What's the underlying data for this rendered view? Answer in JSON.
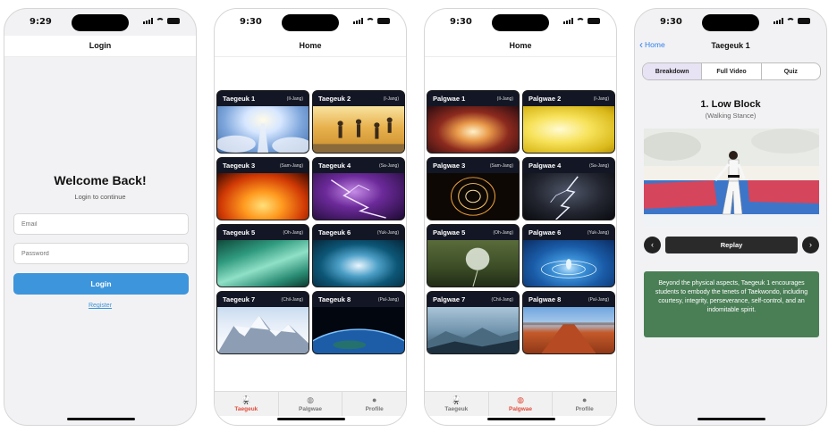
{
  "screens": {
    "login": {
      "time": "9:29",
      "title": "Login",
      "heading": "Welcome Back!",
      "subheading": "Login to continue",
      "email_placeholder": "Email",
      "password_placeholder": "Password",
      "login_label": "Login",
      "register_label": "Register"
    },
    "home_taegeuk": {
      "time": "9:30",
      "title": "Home",
      "cards": [
        {
          "name": "Taegeuk 1",
          "sub": "(Il-Jang)"
        },
        {
          "name": "Taegeuk 2",
          "sub": "(I-Jang)"
        },
        {
          "name": "Taegeuk 3",
          "sub": "(Sam-Jang)"
        },
        {
          "name": "Taegeuk 4",
          "sub": "(Sa-Jang)"
        },
        {
          "name": "Taegeuk 5",
          "sub": "(Oh-Jang)"
        },
        {
          "name": "Taegeuk 6",
          "sub": "(Yuk-Jang)"
        },
        {
          "name": "Taegeuk 7",
          "sub": "(Chil-Jang)"
        },
        {
          "name": "Taegeuk 8",
          "sub": "(Pal-Jang)"
        }
      ],
      "tabs": [
        "Taegeuk",
        "Palgwae",
        "Profile"
      ],
      "active_tab": "Taegeuk"
    },
    "home_palgwae": {
      "time": "9:30",
      "title": "Home",
      "cards": [
        {
          "name": "Palgwae 1",
          "sub": "(Il-Jang)"
        },
        {
          "name": "Palgwae 2",
          "sub": "(I-Jang)"
        },
        {
          "name": "Palgwae 3",
          "sub": "(Sam-Jang)"
        },
        {
          "name": "Palgwae 4",
          "sub": "(Sa-Jang)"
        },
        {
          "name": "Palgwae 5",
          "sub": "(Oh-Jang)"
        },
        {
          "name": "Palgwae 6",
          "sub": "(Yuk-Jang)"
        },
        {
          "name": "Palgwae 7",
          "sub": "(Chil-Jang)"
        },
        {
          "name": "Palgwae 8",
          "sub": "(Pal-Jang)"
        }
      ],
      "tabs": [
        "Taegeuk",
        "Palgwae",
        "Profile"
      ],
      "active_tab": "Palgwae"
    },
    "detail": {
      "time": "9:30",
      "back_label": "Home",
      "title": "Taegeuk 1",
      "segments": [
        "Breakdown",
        "Full Video",
        "Quiz"
      ],
      "active_segment": "Breakdown",
      "step_title": "1. Low Block",
      "step_subtitle": "(Walking Stance)",
      "replay_label": "Replay",
      "info_text": "Beyond the physical aspects, Taegeuk 1 encourages students to embody the tenets of Taekwondo, including courtesy, integrity, perseverance, self-control, and an indomitable spirit."
    }
  },
  "icons": {
    "tab_taegeuk": "kick-icon",
    "tab_palgwae": "globe-icon",
    "tab_profile": "person-icon",
    "back": "chevron-left-icon",
    "prev": "chevron-left-icon",
    "next": "chevron-right-icon"
  },
  "colors": {
    "accent_blue": "#3d95db",
    "active_tab": "#e24b3b",
    "info_box": "#4a7f56",
    "segment_active": "#e7e2f4"
  }
}
